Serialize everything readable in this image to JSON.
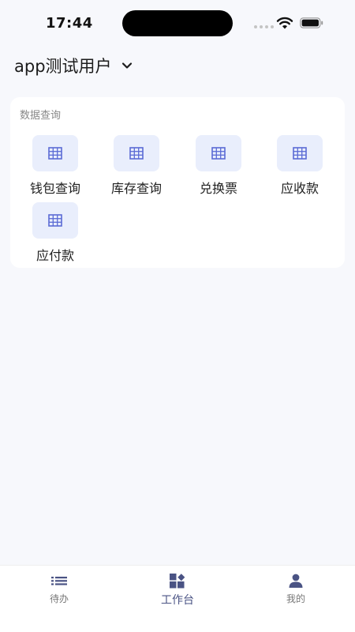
{
  "status_bar": {
    "time": "17:44",
    "icons": [
      "signal-dots-icon",
      "wifi-icon",
      "battery-icon"
    ]
  },
  "header": {
    "account_name": "app测试用户",
    "dropdown_icon": "chevron-down-icon"
  },
  "section": {
    "title": "数据查询",
    "items": [
      {
        "label": "钱包查询",
        "icon": "grid-icon"
      },
      {
        "label": "库存查询",
        "icon": "grid-icon"
      },
      {
        "label": "兑换票",
        "icon": "grid-icon"
      },
      {
        "label": "应收款",
        "icon": "grid-icon"
      },
      {
        "label": "应付款",
        "icon": "grid-icon"
      }
    ]
  },
  "tab_bar": {
    "active_tab": "工作台",
    "tabs": [
      {
        "label": "待办",
        "icon": "list-icon"
      },
      {
        "label": "工作台",
        "icon": "workbench-icon"
      },
      {
        "label": "我的",
        "icon": "person-icon"
      }
    ]
  },
  "colors": {
    "background": "#f7f8fc",
    "card": "#ffffff",
    "tile_bg": "#e9eefc",
    "icon_accent": "#5b6bd5",
    "active_tab": "#4a5384",
    "inactive_tab": "#777777"
  }
}
